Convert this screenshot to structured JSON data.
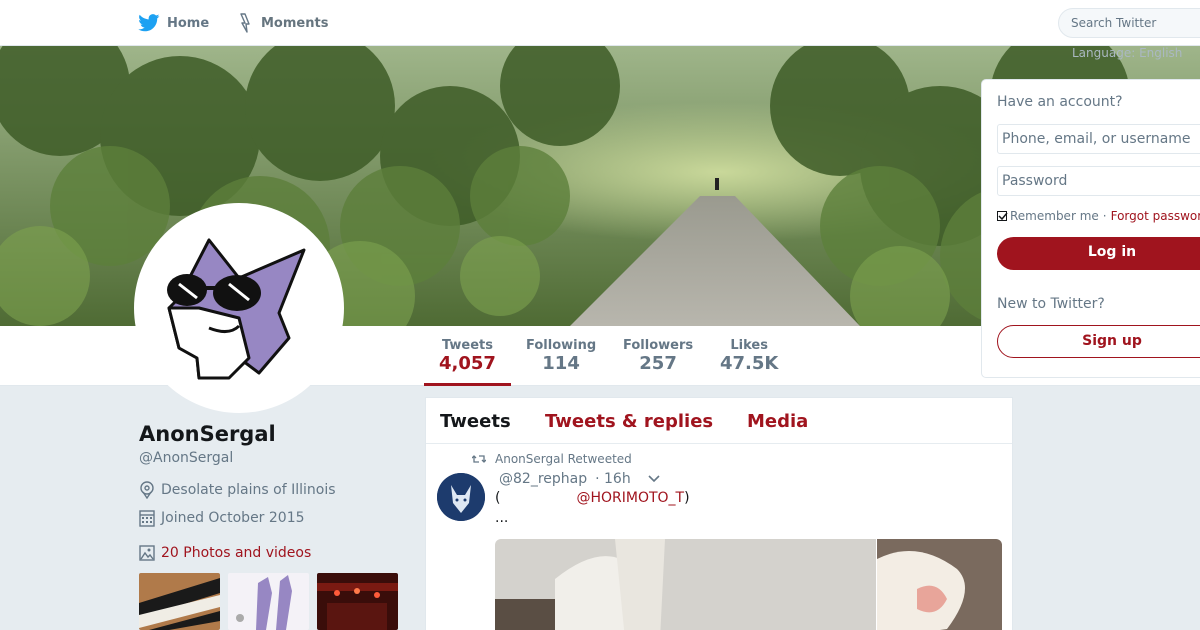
{
  "nav": {
    "home_label": "Home",
    "moments_label": "Moments",
    "search_placeholder": "Search Twitter",
    "language_label": "Have an account?",
    "language_partial": "Language: English"
  },
  "profile_nav": {
    "stats": [
      {
        "label": "Tweets",
        "value": "4,057"
      },
      {
        "label": "Following",
        "value": "114"
      },
      {
        "label": "Followers",
        "value": "257"
      },
      {
        "label": "Likes",
        "value": "47.5K"
      }
    ]
  },
  "profile": {
    "name": "AnonSergal",
    "handle": "@AnonSergal",
    "location": "Desolate plains of Illinois",
    "joined": "Joined October 2015",
    "photos_link": "20 Photos and videos"
  },
  "timeline": {
    "tabs": [
      "Tweets",
      "Tweets & replies",
      "Media"
    ],
    "tweet": {
      "retweeted_by": "AnonSergal Retweeted",
      "handle": "@82_rephap",
      "time": "· 16h",
      "text_open": "(",
      "mention": "@HORIMOTO_T",
      "text_close": ")",
      "more": "..."
    }
  },
  "login": {
    "question": "Have an account?",
    "username_placeholder": "Phone, email, or username",
    "password_placeholder": "Password",
    "remember": "Remember me",
    "separator": "·",
    "forgot": "Forgot password?",
    "login_button": "Log in",
    "new_question": "New to Twitter?",
    "signup_button": "Sign up"
  },
  "colors": {
    "accent": "#a0141e",
    "muted": "#657786",
    "background": "#e6ecf0"
  }
}
